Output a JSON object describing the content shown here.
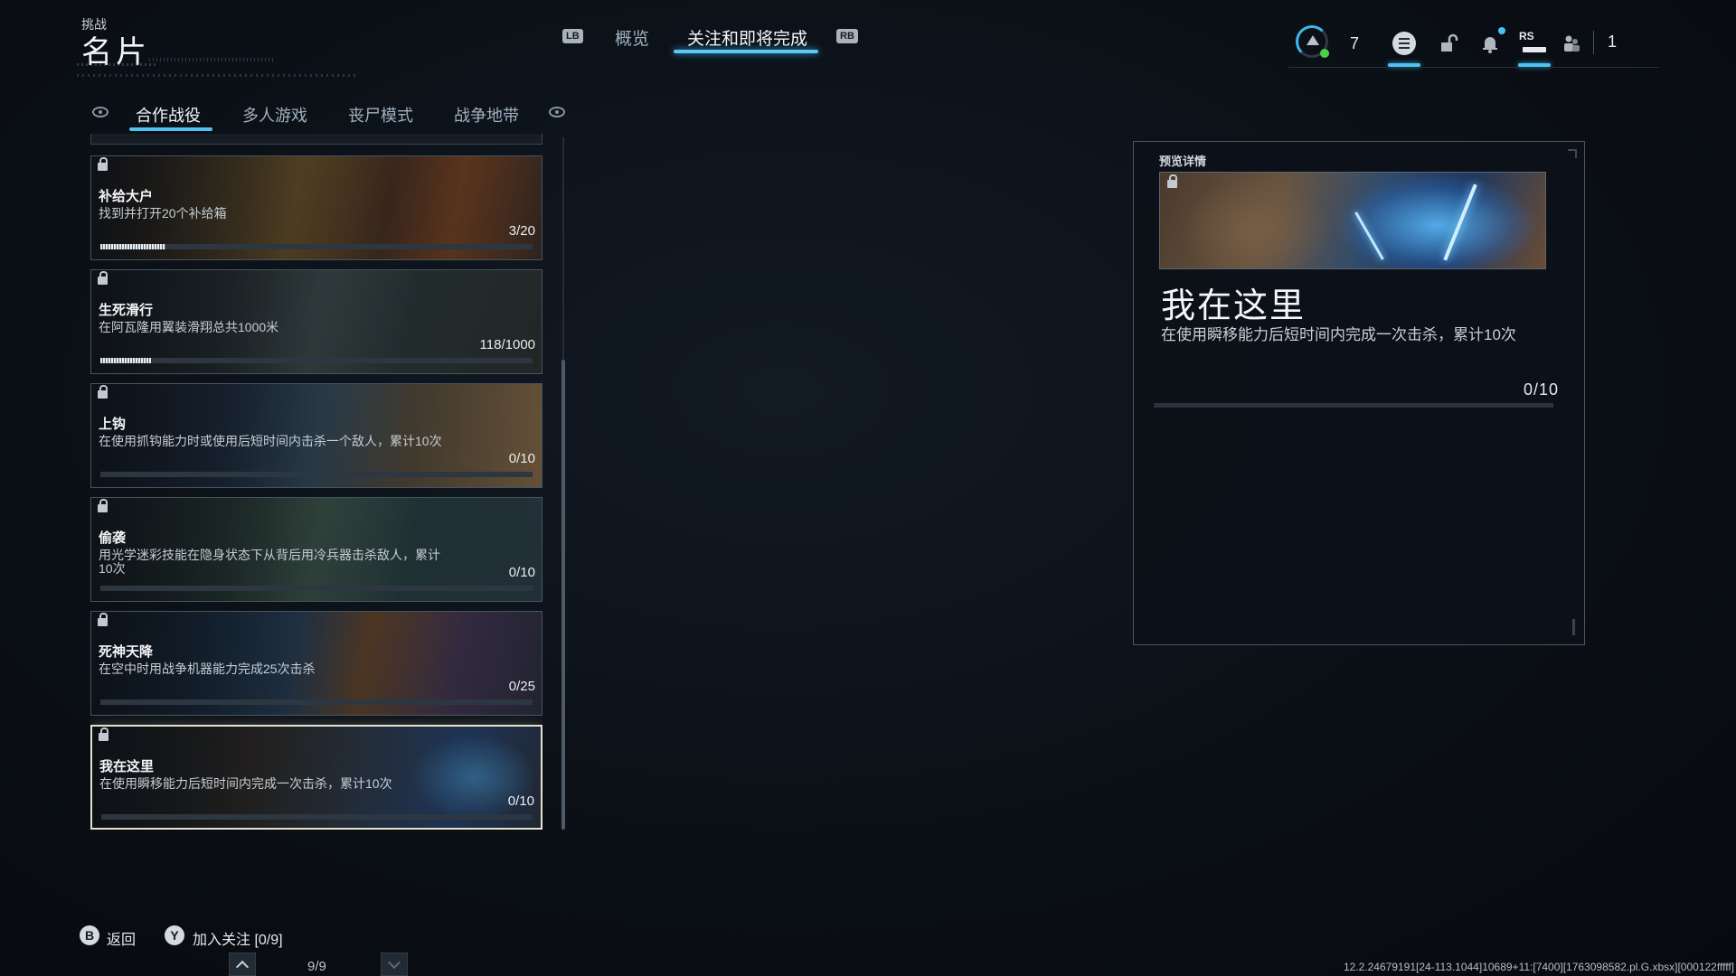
{
  "header": {
    "subtitle": "挑战",
    "title": "名片"
  },
  "top_tabs": {
    "lb": "LB",
    "rb": "RB",
    "items": [
      "概览",
      "关注和即将完成"
    ],
    "active_index": 1
  },
  "status": {
    "level": "7",
    "rs": "RS",
    "count": "1"
  },
  "sub_tabs": {
    "items": [
      "合作战役",
      "多人游戏",
      "丧尸模式",
      "战争地带"
    ],
    "active_index": 0
  },
  "challenges": [
    {
      "title": "补给大户",
      "desc": "找到并打开20个补给箱",
      "progress": "3/20",
      "fraction": 0.15
    },
    {
      "title": "生死滑行",
      "desc": "在阿瓦隆用翼装滑翔总共1000米",
      "progress": "118/1000",
      "fraction": 0.118
    },
    {
      "title": "上钩",
      "desc": "在使用抓钩能力时或使用后短时间内击杀一个敌人，累计10次",
      "progress": "0/10",
      "fraction": 0
    },
    {
      "title": "偷袭",
      "desc": "用光学迷彩技能在隐身状态下从背后用冷兵器击杀敌人，累计10次",
      "progress": "0/10",
      "fraction": 0
    },
    {
      "title": "死神天降",
      "desc": "在空中时用战争机器能力完成25次击杀",
      "progress": "0/25",
      "fraction": 0
    },
    {
      "title": "我在这里",
      "desc": "在使用瞬移能力后短时间内完成一次击杀，累计10次",
      "progress": "0/10",
      "fraction": 0,
      "selected": true
    }
  ],
  "detail": {
    "label": "预览详情",
    "title": "我在这里",
    "desc": "在使用瞬移能力后短时间内完成一次击杀，累计10次",
    "progress": "0/10"
  },
  "footer": {
    "back_key": "B",
    "back_label": "返回",
    "follow_key": "Y",
    "follow_label": "加入关注 [0/9]",
    "page": "9/9",
    "debug": "12.2.24679191[24-113.1044]10689+11:[7400][1763098582.pl.G.xbsx][000122fffff]"
  }
}
